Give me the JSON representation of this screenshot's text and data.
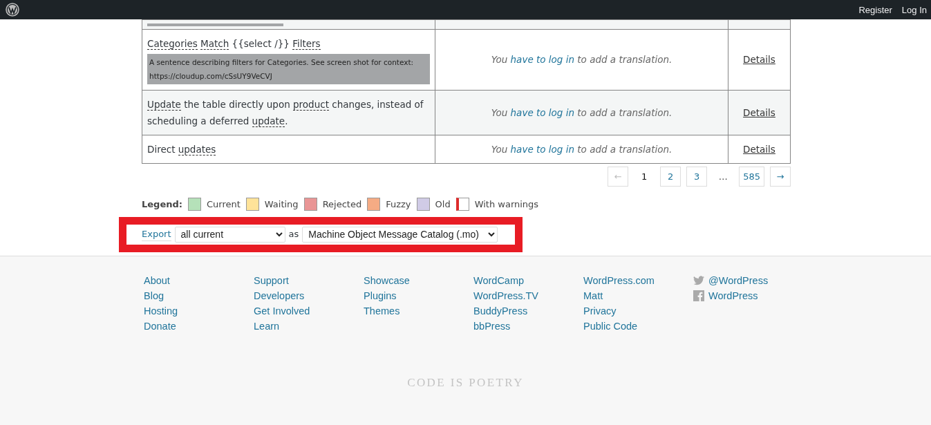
{
  "admin_bar": {
    "links": [
      "Register",
      "Log In"
    ]
  },
  "table": {
    "rows": [
      {
        "kind": "cut_off"
      },
      {
        "kind": "string",
        "original": [
          {
            "text": "Categories",
            "glossary": true
          },
          {
            "text": "Match",
            "glossary": true,
            "space_before": true
          },
          {
            "text": "{{select /}}",
            "space_before": true
          },
          {
            "text": "Filters",
            "glossary": true,
            "space_before": true
          }
        ],
        "context": "A sentence describing filters for Categories. See screen shot for context: https://cloudup.com/cSsUY9VeCVJ",
        "translation": {
          "prefix": "You ",
          "link": "have to log in",
          "suffix": " to add a translation."
        },
        "details": "Details"
      },
      {
        "kind": "string",
        "original": [
          {
            "text": "Update",
            "glossary": true
          },
          {
            "text": "the table directly upon",
            "space_before": true
          },
          {
            "text": "product",
            "glossary": true,
            "space_before": true
          },
          {
            "text": "changes, instead of scheduling a deferred",
            "space_before": true
          },
          {
            "text": "update",
            "glossary": true,
            "space_before": true
          },
          {
            "text": "."
          }
        ],
        "translation": {
          "prefix": "You ",
          "link": "have to log in",
          "suffix": " to add a translation."
        },
        "details": "Details"
      },
      {
        "kind": "string",
        "original": [
          {
            "text": "Direct"
          },
          {
            "text": "updates",
            "glossary": true,
            "space_before": true
          }
        ],
        "translation": {
          "prefix": "You ",
          "link": "have to log in",
          "suffix": " to add a translation."
        },
        "details": "Details"
      }
    ]
  },
  "pagination": [
    {
      "label": "←",
      "kind": "prev",
      "disabled": true,
      "selected": false
    },
    {
      "label": "1",
      "kind": "page",
      "disabled": false,
      "selected": true
    },
    {
      "label": "2",
      "kind": "page",
      "disabled": false,
      "selected": false
    },
    {
      "label": "3",
      "kind": "page",
      "disabled": false,
      "selected": false
    },
    {
      "label": "…",
      "kind": "gap",
      "disabled": false,
      "selected": false
    },
    {
      "label": "585",
      "kind": "page",
      "disabled": false,
      "selected": false
    },
    {
      "label": "→",
      "kind": "next",
      "disabled": false,
      "selected": false
    }
  ],
  "legend": {
    "label": "Legend:",
    "items": [
      {
        "label": "Current",
        "kind": "swatch",
        "color": "#b5e1b9"
      },
      {
        "label": "Waiting",
        "kind": "swatch",
        "color": "#ffe399"
      },
      {
        "label": "Rejected",
        "kind": "swatch",
        "color": "#e99595"
      },
      {
        "label": "Fuzzy",
        "kind": "swatch",
        "color": "#f5ab84"
      },
      {
        "label": "Old",
        "kind": "swatch",
        "color": "#d0cbe6"
      },
      {
        "label": "With warnings",
        "kind": "warning",
        "color": "#dd2c2c"
      }
    ]
  },
  "export": {
    "link": "Export",
    "what": "all current",
    "as": "as",
    "format": "Machine Object Message Catalog (.mo)"
  },
  "footer": {
    "columns": [
      [
        {
          "label": "About",
          "kind": "link"
        },
        {
          "label": "Blog",
          "kind": "link"
        },
        {
          "label": "Hosting",
          "kind": "link"
        },
        {
          "label": "Donate",
          "kind": "link"
        }
      ],
      [
        {
          "label": "Support",
          "kind": "link"
        },
        {
          "label": "Developers",
          "kind": "link"
        },
        {
          "label": "Get Involved",
          "kind": "link"
        },
        {
          "label": "Learn",
          "kind": "link"
        }
      ],
      [
        {
          "label": "Showcase",
          "kind": "link"
        },
        {
          "label": "Plugins",
          "kind": "link"
        },
        {
          "label": "Themes",
          "kind": "link"
        }
      ],
      [
        {
          "label": "WordCamp",
          "kind": "link"
        },
        {
          "label": "WordPress.TV",
          "kind": "link"
        },
        {
          "label": "BuddyPress",
          "kind": "link"
        },
        {
          "label": "bbPress",
          "kind": "link"
        }
      ],
      [
        {
          "label": "WordPress.com",
          "kind": "link"
        },
        {
          "label": "Matt",
          "kind": "link"
        },
        {
          "label": "Privacy",
          "kind": "link"
        },
        {
          "label": "Public Code",
          "kind": "link"
        }
      ],
      [
        {
          "label": "@WordPress",
          "kind": "bird"
        },
        {
          "label": "WordPress",
          "kind": "f_square"
        }
      ]
    ],
    "tagline": "CODE IS POETRY"
  }
}
